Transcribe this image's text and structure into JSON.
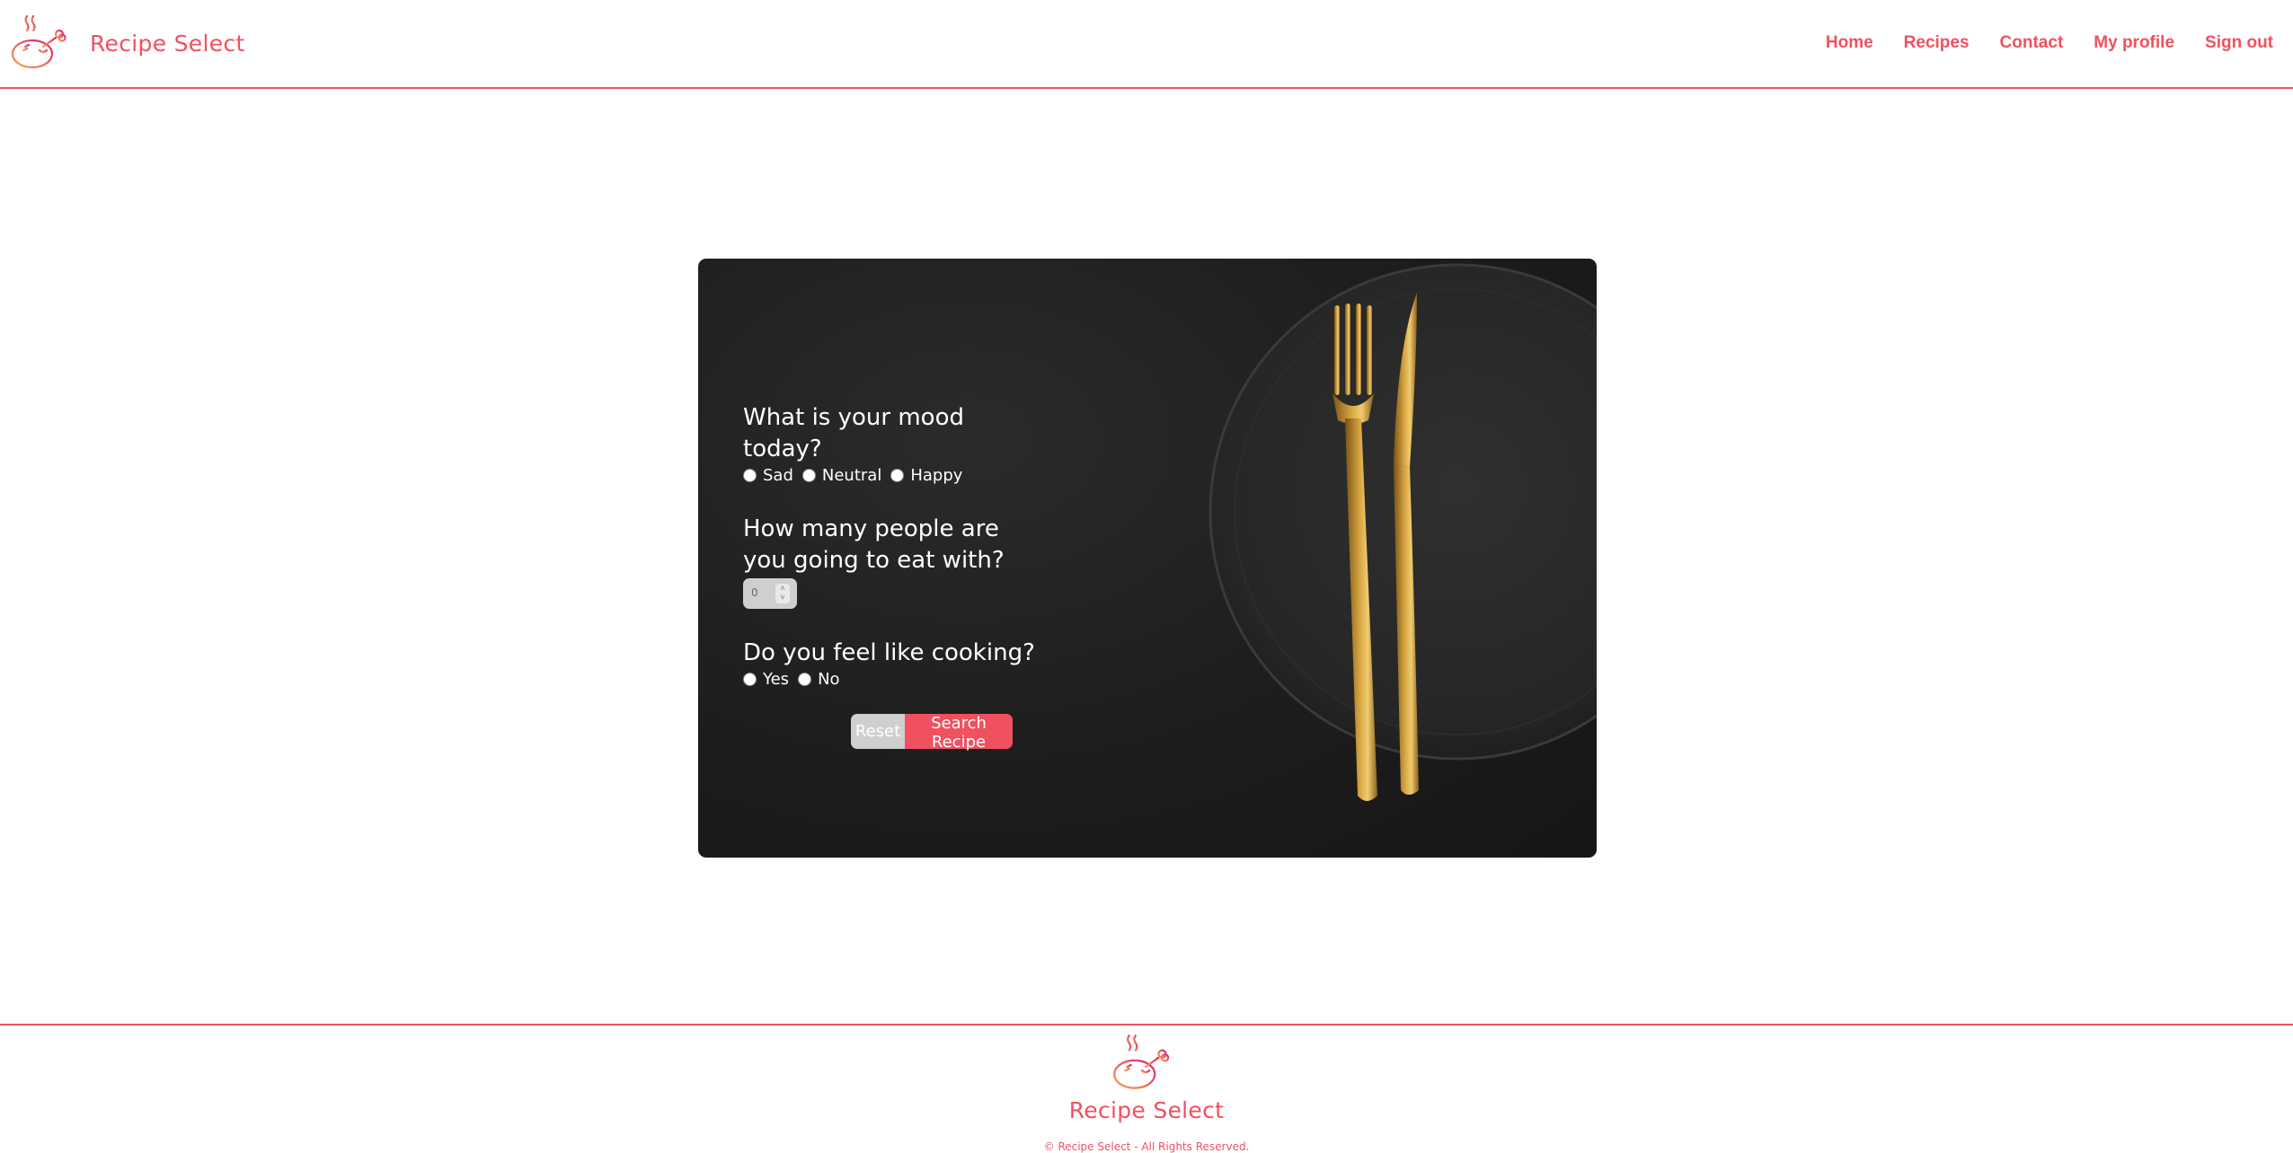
{
  "header": {
    "brand_name": "Recipe Select",
    "logo_icon": "roast-chicken-icon",
    "nav": [
      {
        "label": "Home"
      },
      {
        "label": "Recipes"
      },
      {
        "label": "Contact"
      },
      {
        "label": "My profile"
      },
      {
        "label": "Sign out"
      }
    ]
  },
  "form": {
    "mood": {
      "question": "What is your mood today?",
      "options": [
        "Sad",
        "Neutral",
        "Happy"
      ]
    },
    "people": {
      "question": "How many people are you going to eat with?",
      "value": "0"
    },
    "cooking": {
      "question": "Do you feel like cooking?",
      "options": [
        "Yes",
        "No"
      ]
    },
    "reset_label": "Reset",
    "search_label": "Search Recipe"
  },
  "footer": {
    "brand_name": "Recipe Select",
    "copyright": "© Recipe Select - All Rights Reserved."
  },
  "colors": {
    "accent": "#f0515f",
    "card_bg": "#1d1d1d",
    "button_secondary": "#cfcfcf",
    "gold": "#c9962e"
  }
}
